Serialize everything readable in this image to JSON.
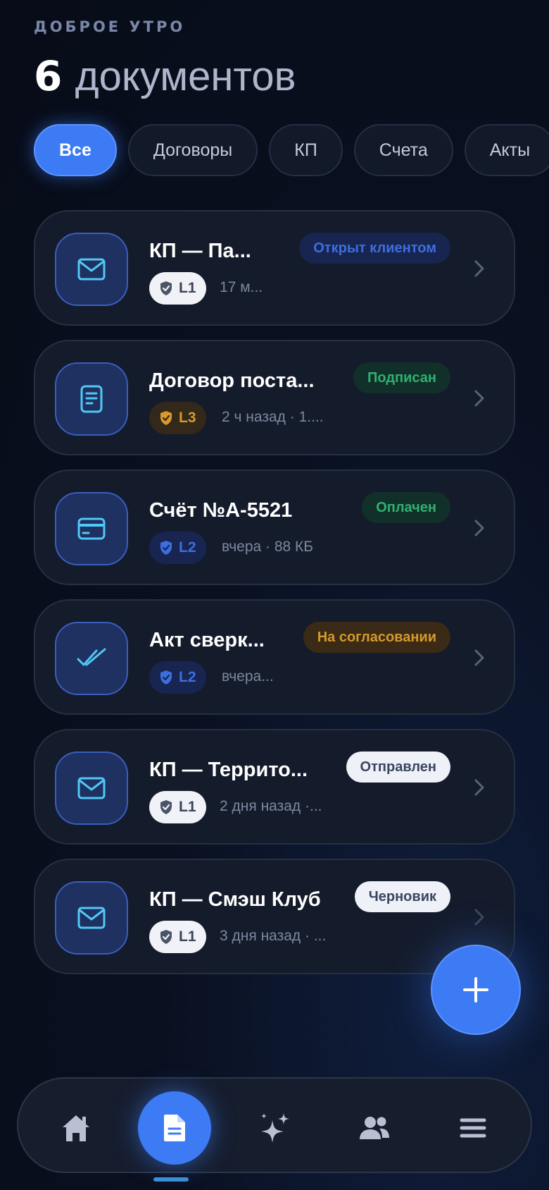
{
  "header": {
    "greeting": "ДОБРОЕ УТРО",
    "count": "6",
    "count_word": "документов"
  },
  "filters": [
    {
      "label": "Все",
      "active": true
    },
    {
      "label": "Договоры",
      "active": false
    },
    {
      "label": "КП",
      "active": false
    },
    {
      "label": "Счета",
      "active": false
    },
    {
      "label": "Акты",
      "active": false
    }
  ],
  "documents": [
    {
      "icon": "envelope-icon",
      "title": "КП — Па...",
      "status": "Открыт клиентом",
      "status_color": "#3d6ee0",
      "level": "L1",
      "meta": "17 м..."
    },
    {
      "icon": "document-icon",
      "title": "Договор поста...",
      "status": "Подписан",
      "status_color": "#2fb170",
      "level": "L3",
      "meta": "2 ч назад · 1...."
    },
    {
      "icon": "credit-card-icon",
      "title": "Счёт №А-5521",
      "status": "Оплачен",
      "status_color": "#2fb170",
      "level": "L2",
      "meta": "вчера · 88 КБ"
    },
    {
      "icon": "double-check-icon",
      "title": "Акт сверк...",
      "status": "На согласовании",
      "status_color": "#d59a2a",
      "level": "L2",
      "meta": "вчера..."
    },
    {
      "icon": "envelope-icon",
      "title": "КП — Террито...",
      "status": "Отправлен",
      "status_color": "#3a4560",
      "level": "L1",
      "meta": "2 дня назад ·..."
    },
    {
      "icon": "envelope-icon",
      "title": "КП — Смэш Клуб",
      "status": "Черновик",
      "status_color": "#3a4560",
      "level": "L1",
      "meta": "3 дня назад · ..."
    }
  ],
  "fab": {
    "icon": "plus-icon"
  },
  "nav": [
    {
      "icon": "home-icon",
      "active": false
    },
    {
      "icon": "document-icon",
      "active": true
    },
    {
      "icon": "sparkles-icon",
      "active": false
    },
    {
      "icon": "users-icon",
      "active": false
    },
    {
      "icon": "menu-icon",
      "active": false
    }
  ],
  "colors": {
    "accent": "#3d7bf5",
    "background": "#0a1020",
    "card": "#141b2b"
  }
}
